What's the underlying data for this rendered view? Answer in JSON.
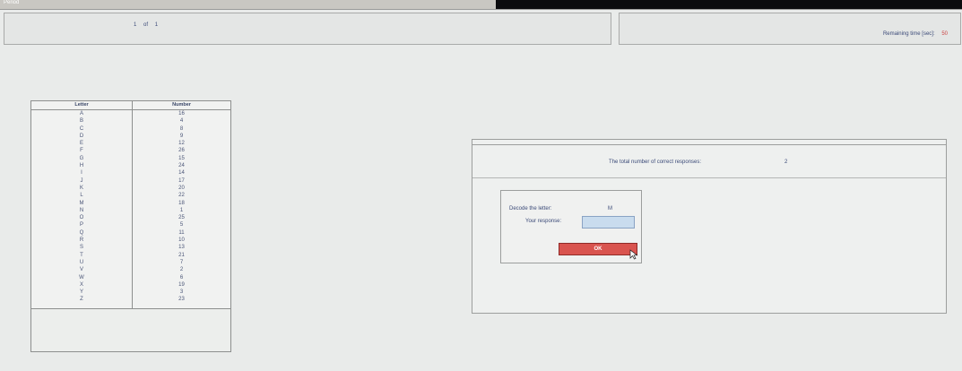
{
  "window": {
    "title": "Period"
  },
  "header": {
    "page_current": "1",
    "page_of": "of",
    "page_total": "1",
    "remaining_label": "Remaining time [sec]:",
    "remaining_value": "50"
  },
  "table": {
    "header_letter": "Letter",
    "header_number": "Number",
    "rows": [
      {
        "letter": "A",
        "number": "16"
      },
      {
        "letter": "B",
        "number": "4"
      },
      {
        "letter": "C",
        "number": "8"
      },
      {
        "letter": "D",
        "number": "9"
      },
      {
        "letter": "E",
        "number": "12"
      },
      {
        "letter": "F",
        "number": "26"
      },
      {
        "letter": "G",
        "number": "15"
      },
      {
        "letter": "H",
        "number": "24"
      },
      {
        "letter": "I",
        "number": "14"
      },
      {
        "letter": "J",
        "number": "17"
      },
      {
        "letter": "K",
        "number": "20"
      },
      {
        "letter": "L",
        "number": "22"
      },
      {
        "letter": "M",
        "number": "18"
      },
      {
        "letter": "N",
        "number": "1"
      },
      {
        "letter": "O",
        "number": "25"
      },
      {
        "letter": "P",
        "number": "5"
      },
      {
        "letter": "Q",
        "number": "11"
      },
      {
        "letter": "R",
        "number": "10"
      },
      {
        "letter": "S",
        "number": "13"
      },
      {
        "letter": "T",
        "number": "21"
      },
      {
        "letter": "U",
        "number": "7"
      },
      {
        "letter": "V",
        "number": "2"
      },
      {
        "letter": "W",
        "number": "6"
      },
      {
        "letter": "X",
        "number": "19"
      },
      {
        "letter": "Y",
        "number": "3"
      },
      {
        "letter": "Z",
        "number": "23"
      }
    ]
  },
  "result": {
    "correct_label": "The total number of correct responses:",
    "correct_value": "2"
  },
  "decode": {
    "prompt": "Decode the letter:",
    "letter": "M",
    "response_label": "Your response:",
    "response_value": "",
    "ok_label": "OK"
  },
  "colors": {
    "ok_button": "#d9544f",
    "input_bg": "#c9dcee",
    "remaining_value": "#cc4444"
  },
  "icons": {
    "cursor": "mouse-pointer-icon"
  }
}
